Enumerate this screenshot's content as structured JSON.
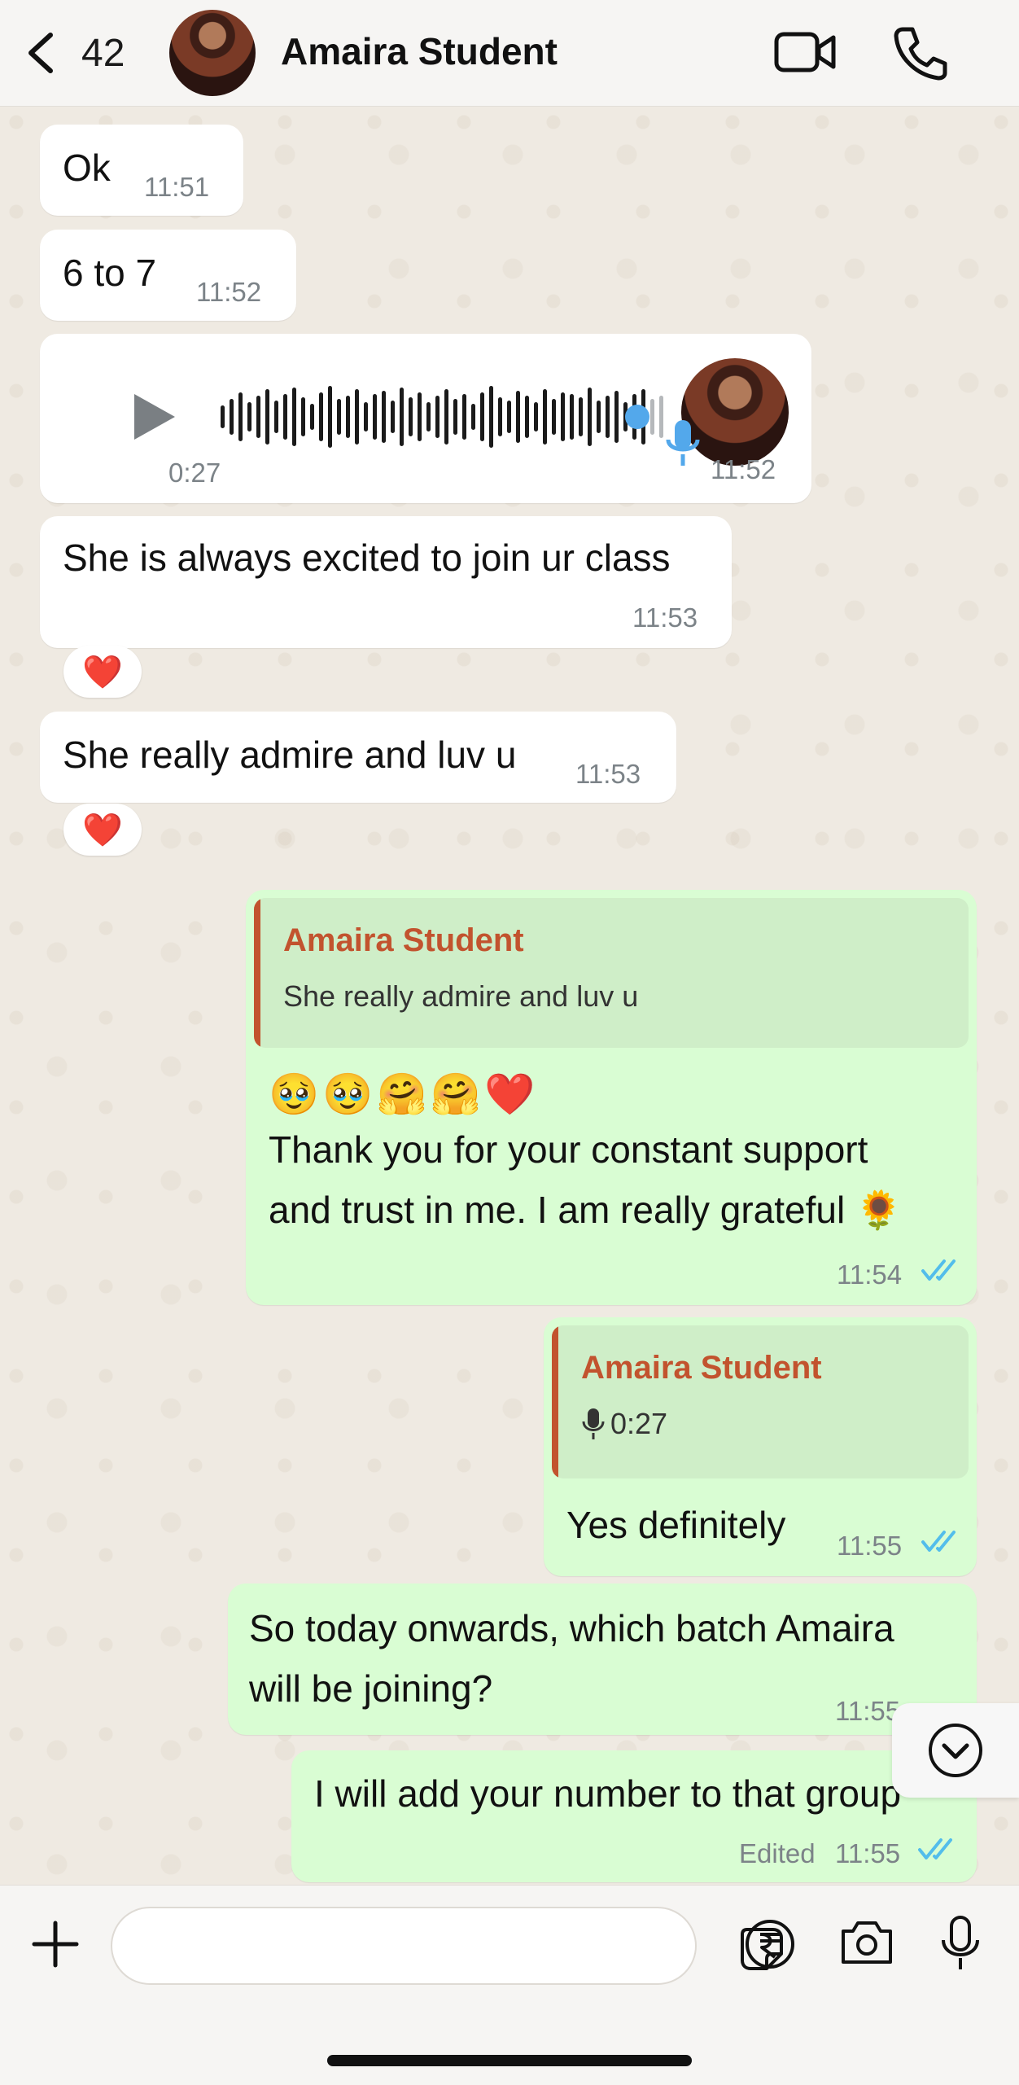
{
  "header": {
    "back_count": "42",
    "contact_name": "Amaira Student"
  },
  "messages": [
    {
      "dir": "in",
      "text": "Ok",
      "time": "11:51"
    },
    {
      "dir": "in",
      "text": "6 to 7",
      "time": "11:52"
    },
    {
      "dir": "in",
      "type": "voice",
      "duration": "0:27",
      "time": "11:52",
      "progress": 0.95
    },
    {
      "dir": "in",
      "text": "She is always excited to join ur class",
      "time": "11:53",
      "reaction": "❤️"
    },
    {
      "dir": "in",
      "text": "She really admire and luv u",
      "time": "11:53",
      "reaction": "❤️"
    },
    {
      "dir": "out",
      "quote_name": "Amaira Student",
      "quote_text": "She really admire and luv u",
      "emojis": "🥹🥹🤗🤗❤️",
      "line1": "Thank you for your constant support",
      "line2": "and trust in me. I am really grateful 🌻",
      "time": "11:54"
    },
    {
      "dir": "out",
      "quote_name": "Amaira Student",
      "quote_text": "0:27",
      "text": "Yes definitely",
      "time": "11:55"
    },
    {
      "dir": "out",
      "line1": "So today onwards, which batch Amaira",
      "line2": "will be joining?",
      "time": "11:55"
    },
    {
      "dir": "out",
      "text": "I will add your number to that group",
      "edited": "Edited",
      "time": "11:55"
    }
  ],
  "composer": {
    "value": "",
    "placeholder": ""
  },
  "icons": [
    "back-chevron-icon",
    "video-call-icon",
    "phone-icon",
    "play-icon",
    "mic-icon",
    "plus-icon",
    "sticker-icon",
    "rupee-icon",
    "camera-icon",
    "chevron-down-icon"
  ],
  "colors": {
    "outgoing_bubble": "#d9fdd3",
    "incoming_bubble": "#ffffff",
    "quote_name": "#c2532e",
    "read_ticks": "#53bdeb",
    "background": "#efeae2"
  }
}
